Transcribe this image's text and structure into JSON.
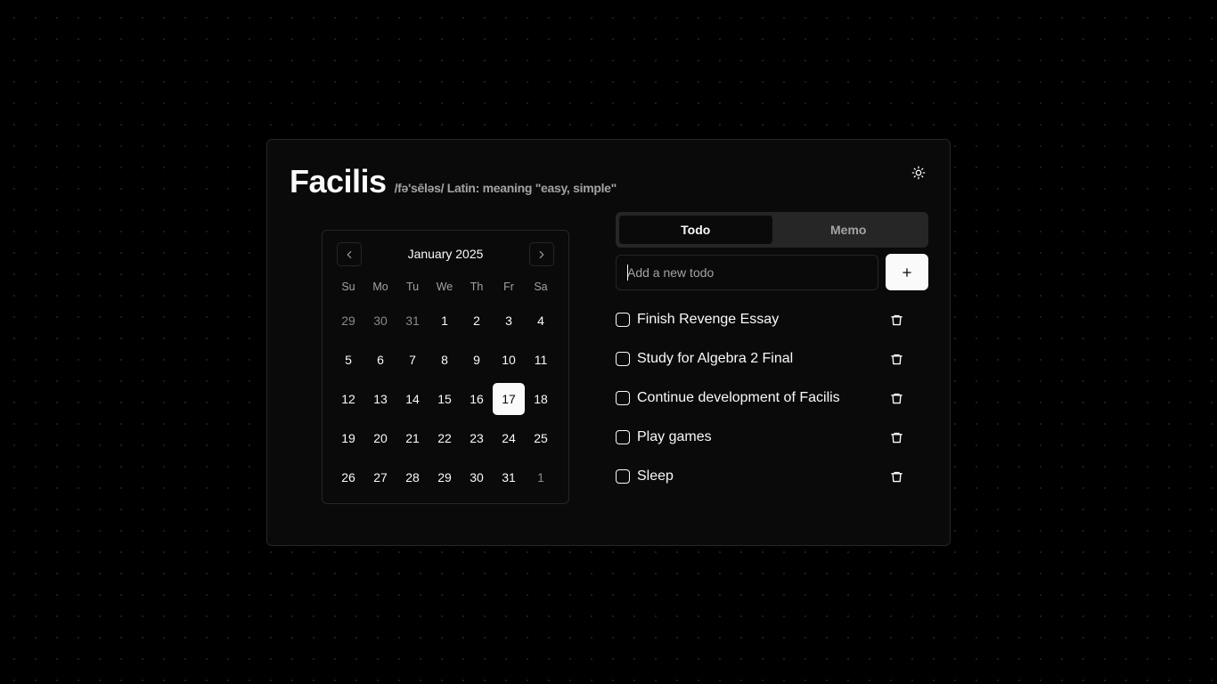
{
  "app": {
    "title": "Facilis",
    "subtitle": "/fə'sēləs/ Latin: meaning \"easy, simple\""
  },
  "theme_toggle": {
    "icon": "sun-icon"
  },
  "calendar": {
    "month_label": "January 2025",
    "weekdays": [
      "Su",
      "Mo",
      "Tu",
      "We",
      "Th",
      "Fr",
      "Sa"
    ],
    "selected_day": "17",
    "weeks": [
      [
        {
          "d": "29",
          "out": true
        },
        {
          "d": "30",
          "out": true
        },
        {
          "d": "31",
          "out": true
        },
        {
          "d": "1"
        },
        {
          "d": "2"
        },
        {
          "d": "3"
        },
        {
          "d": "4"
        }
      ],
      [
        {
          "d": "5"
        },
        {
          "d": "6"
        },
        {
          "d": "7"
        },
        {
          "d": "8"
        },
        {
          "d": "9"
        },
        {
          "d": "10"
        },
        {
          "d": "11"
        }
      ],
      [
        {
          "d": "12"
        },
        {
          "d": "13"
        },
        {
          "d": "14"
        },
        {
          "d": "15"
        },
        {
          "d": "16"
        },
        {
          "d": "17",
          "sel": true
        },
        {
          "d": "18"
        }
      ],
      [
        {
          "d": "19"
        },
        {
          "d": "20"
        },
        {
          "d": "21"
        },
        {
          "d": "22"
        },
        {
          "d": "23"
        },
        {
          "d": "24"
        },
        {
          "d": "25"
        }
      ],
      [
        {
          "d": "26"
        },
        {
          "d": "27"
        },
        {
          "d": "28"
        },
        {
          "d": "29"
        },
        {
          "d": "30"
        },
        {
          "d": "31"
        },
        {
          "d": "1",
          "out": true
        }
      ]
    ]
  },
  "tabs": [
    {
      "label": "Todo",
      "active": true
    },
    {
      "label": "Memo",
      "active": false
    }
  ],
  "todo_input": {
    "value": "",
    "placeholder": "Add a new todo"
  },
  "todos": [
    {
      "text": "Finish Revenge Essay",
      "done": false
    },
    {
      "text": "Study for Algebra 2 Final",
      "done": false
    },
    {
      "text": "Continue development of Facilis",
      "done": false
    },
    {
      "text": "Play games",
      "done": false
    },
    {
      "text": "Sleep",
      "done": false
    }
  ],
  "colors": {
    "background": "#000000",
    "card": "#0a0a0a",
    "border": "#262626",
    "foreground": "#fafafa",
    "muted": "#a3a3a3"
  }
}
